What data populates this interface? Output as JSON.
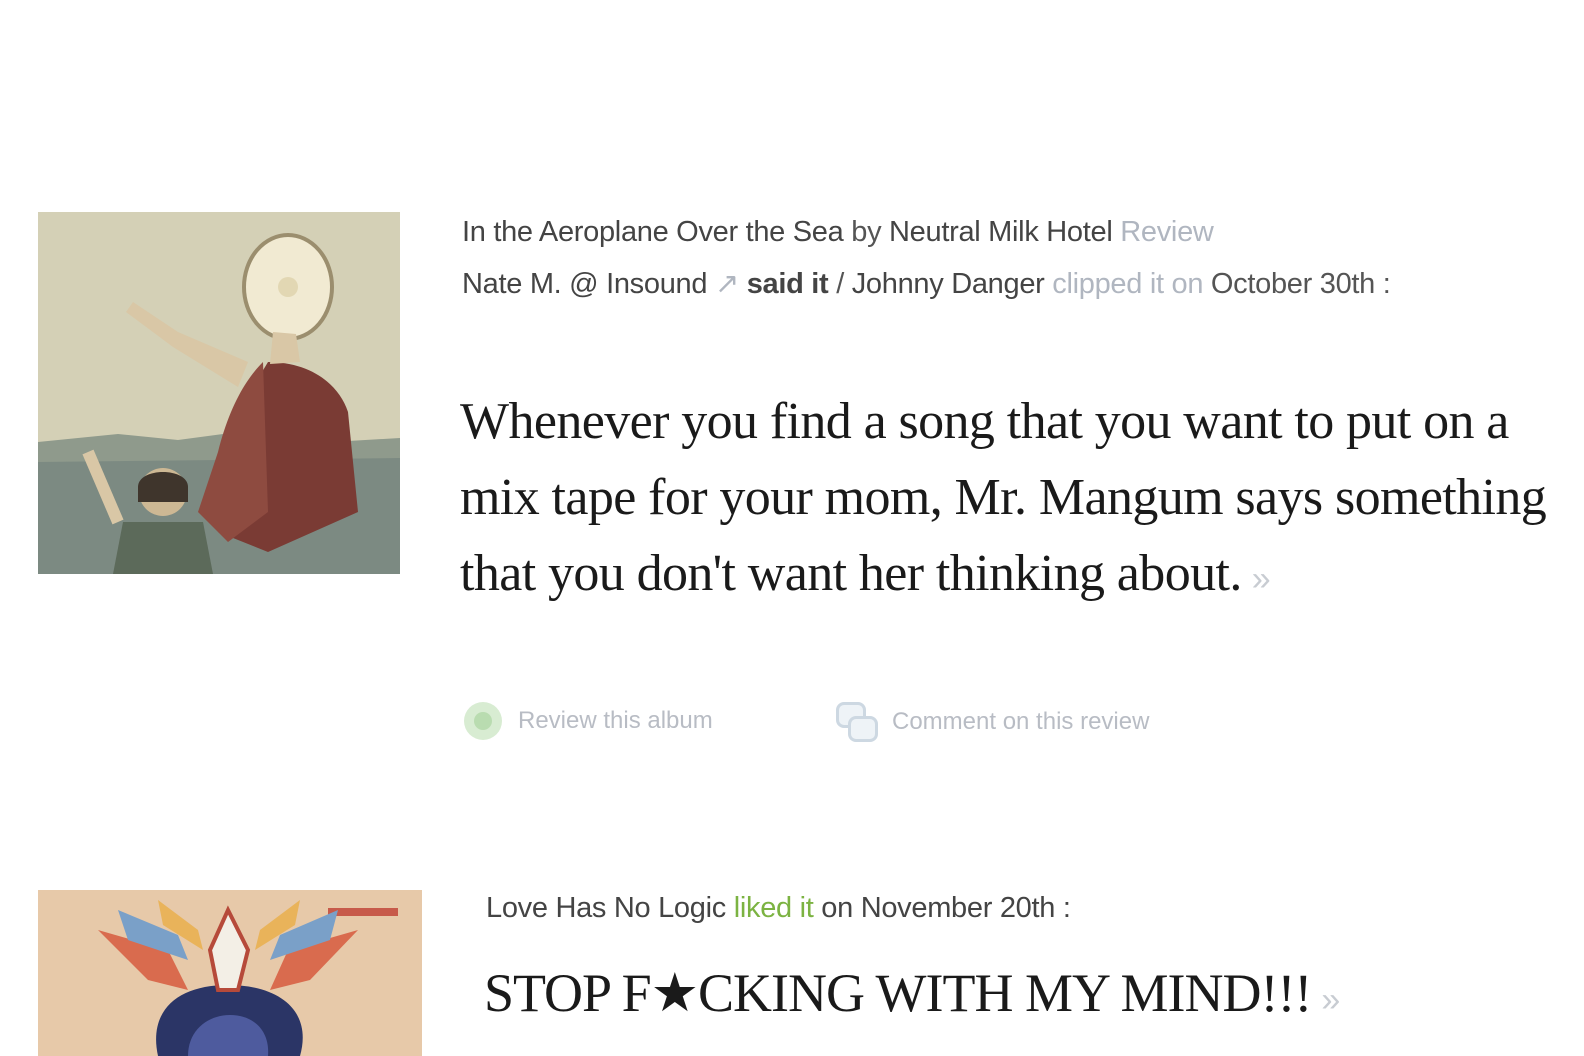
{
  "entries": [
    {
      "album": "In the Aeroplane Over the Sea",
      "by": "by",
      "artist": "Neutral Milk Hotel",
      "type": "Review",
      "reviewer": "Nate M. @ Insound",
      "ext_icon": "external-link-icon",
      "said_it": "said it",
      "sep": "/",
      "clipper": "Johnny Danger",
      "clipped_text": "clipped it on",
      "date": "October 30th :",
      "quote": "Whenever you find a song that you want to put on a mix tape for your mom, Mr. Mangum says something that you don't want her thinking about.",
      "more": "»",
      "actions": {
        "review": "Review this album",
        "comment": "Comment on this review"
      }
    },
    {
      "user": "Love Has No Logic",
      "liked": "liked it",
      "on_date": "on November 20th :",
      "quote": "STOP F★CKING WITH MY MIND!!!",
      "more": "»"
    }
  ],
  "colors": {
    "liked_green": "#7cb342",
    "muted_link": "#b0b6c0"
  }
}
